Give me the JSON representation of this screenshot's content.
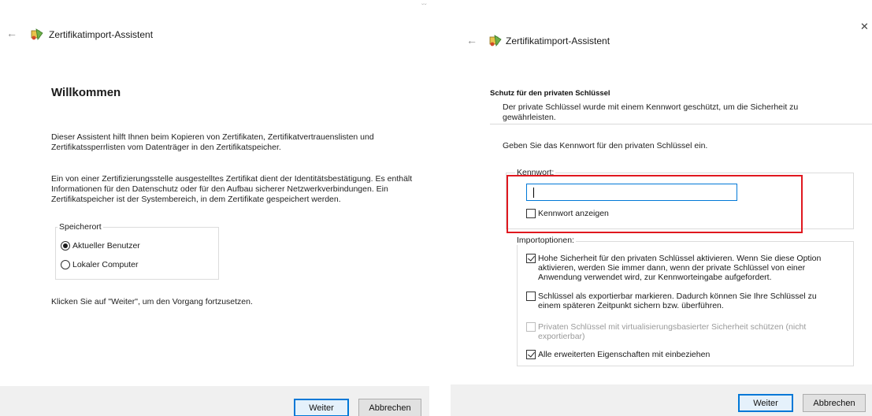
{
  "left": {
    "header": {
      "title": "Zertifikatimport-Assistent"
    },
    "heading": "Willkommen",
    "intro": "Dieser Assistent hilft Ihnen beim Kopieren von Zertifikaten, Zertifikatvertrauenslisten und Zertifikatssperrlisten vom Datenträger in den Zertifikatspeicher.",
    "description": "Ein von einer Zertifizierungsstelle ausgestelltes Zertifikat dient der Identitätsbestätigung. Es enthält Informationen für den Datenschutz oder für den Aufbau sicherer Netzwerkverbindungen. Ein Zertifikatspeicher ist der Systembereich, in dem Zertifikate gespeichert werden.",
    "storage_group": {
      "legend": "Speicherort",
      "options": [
        {
          "label": "Aktueller Benutzer",
          "selected": true
        },
        {
          "label": "Lokaler Computer",
          "selected": false
        }
      ]
    },
    "continue_hint": "Klicken Sie auf \"Weiter\", um den Vorgang fortzusetzen.",
    "buttons": {
      "next": "Weiter",
      "cancel": "Abbrechen"
    }
  },
  "right": {
    "header": {
      "title": "Zertifikatimport-Assistent"
    },
    "section_title": "Schutz für den privaten Schlüssel",
    "section_subtitle": "Der private Schlüssel wurde mit einem Kennwort geschützt, um die Sicherheit zu gewährleisten.",
    "instruction": "Geben Sie das Kennwort für den privaten Schlüssel ein.",
    "password_group": {
      "legend": "Kennwort:",
      "value": "",
      "show_password": {
        "label": "Kennwort anzeigen",
        "checked": false
      }
    },
    "import_options": {
      "legend": "Importoptionen:",
      "options": [
        {
          "label": "Hohe Sicherheit für den privaten Schlüssel aktivieren. Wenn Sie diese Option aktivieren, werden Sie immer dann, wenn der private Schlüssel von einer Anwendung verwendet wird, zur Kennworteingabe aufgefordert.",
          "checked": true,
          "disabled": false
        },
        {
          "label": "Schlüssel als exportierbar markieren. Dadurch können Sie Ihre Schlüssel zu einem späteren Zeitpunkt sichern bzw. überführen.",
          "checked": false,
          "disabled": false
        },
        {
          "label": "Privaten Schlüssel mit virtualisierungsbasierter Sicherheit schützen (nicht exportierbar)",
          "checked": false,
          "disabled": true
        },
        {
          "label": "Alle erweiterten Eigenschaften mit einbeziehen",
          "checked": true,
          "disabled": false
        }
      ]
    },
    "buttons": {
      "next": "Weiter",
      "cancel": "Abbrechen"
    }
  },
  "colors": {
    "accent": "#0078d7",
    "highlight": "#e0181f",
    "footer_bg": "#f0f0f0"
  }
}
